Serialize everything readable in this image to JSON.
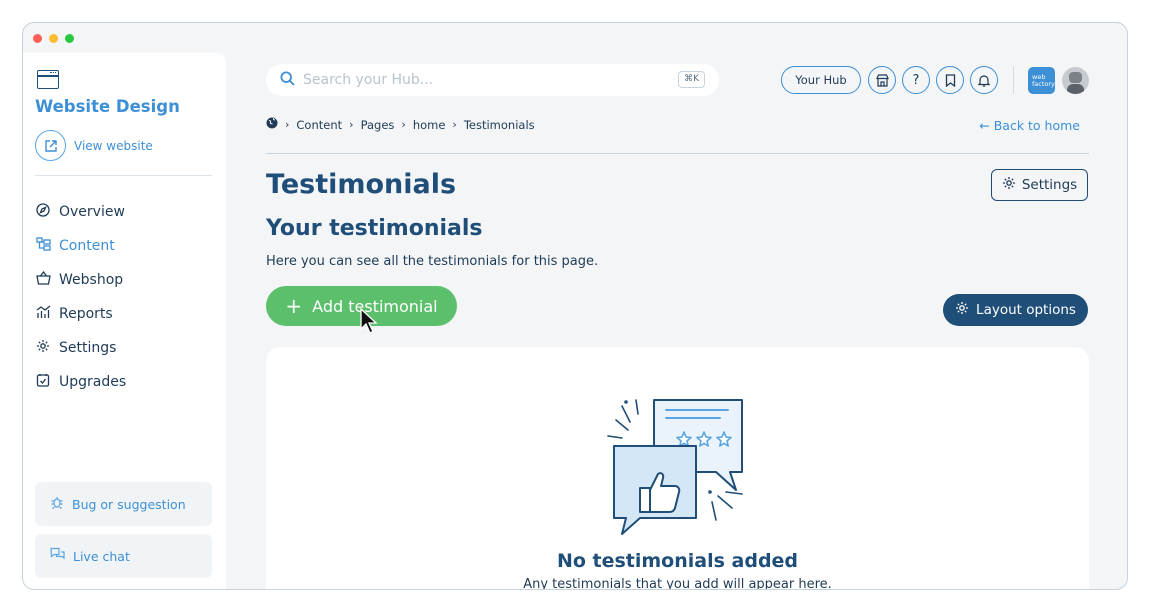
{
  "sidebar": {
    "site_title": "Website Design",
    "view_website": "View website",
    "nav": [
      {
        "label": "Overview",
        "icon": "compass-icon",
        "active": false
      },
      {
        "label": "Content",
        "icon": "content-tree-icon",
        "active": true
      },
      {
        "label": "Webshop",
        "icon": "basket-icon",
        "active": false
      },
      {
        "label": "Reports",
        "icon": "chart-icon",
        "active": false
      },
      {
        "label": "Settings",
        "icon": "gear-icon",
        "active": false
      },
      {
        "label": "Upgrades",
        "icon": "upgrade-icon",
        "active": false
      }
    ],
    "bug_label": "Bug or suggestion",
    "chat_label": "Live chat"
  },
  "topbar": {
    "search_placeholder": "Search your Hub...",
    "shortcut": "⌘K",
    "hub_label": "Your Hub",
    "brand_logo": "web factory"
  },
  "breadcrumb": [
    "Content",
    "Pages",
    "home",
    "Testimonials"
  ],
  "back_link": "← Back to home",
  "page": {
    "title": "Testimonials",
    "settings_label": "Settings",
    "subtitle": "Your testimonials",
    "description": "Here you can see all the testimonials for this page.",
    "add_label": "Add testimonial",
    "layout_label": "Layout options"
  },
  "empty": {
    "title": "No testimonials added",
    "description": "Any testimonials that you add will appear here."
  },
  "colors": {
    "accent": "#3d8fd6",
    "navy": "#1f4e79",
    "green": "#5cbf6b"
  }
}
